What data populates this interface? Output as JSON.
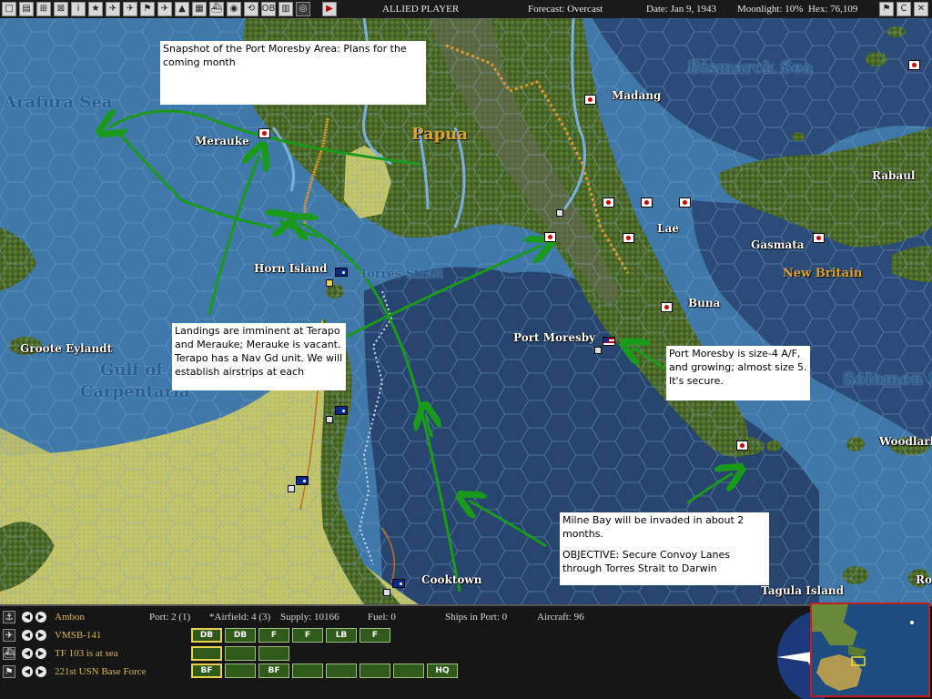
{
  "topbar": {
    "player": "ALLIED PLAYER",
    "forecast": "Forecast: Overcast",
    "date": "Date: Jan 9, 1943",
    "moonlight": "Moonlight: 10%",
    "hex": "Hex: 76,109",
    "tools": [
      {
        "name": "stop-icon",
        "glyph": "□"
      },
      {
        "name": "document-icon",
        "glyph": "▤"
      },
      {
        "name": "ships-icon",
        "glyph": "⊞"
      },
      {
        "name": "map-icon",
        "glyph": "⊠"
      },
      {
        "name": "info-icon",
        "glyph": "i"
      },
      {
        "name": "star-icon",
        "glyph": "★"
      },
      {
        "name": "red-plane-icon",
        "glyph": "✈"
      },
      {
        "name": "red-plane-2-icon",
        "glyph": "✈"
      },
      {
        "name": "flag-icon",
        "glyph": "⚑"
      },
      {
        "name": "aircraft-icon",
        "glyph": "✈"
      },
      {
        "name": "chart-icon",
        "glyph": "▲"
      },
      {
        "name": "green-map-icon",
        "glyph": "▦"
      },
      {
        "name": "ship-icon",
        "glyph": "⛴"
      },
      {
        "name": "globe-icon",
        "glyph": "◉"
      },
      {
        "name": "recycle-icon",
        "glyph": "⟲"
      },
      {
        "name": "ob-icon",
        "glyph": "OB"
      },
      {
        "name": "database-icon",
        "glyph": "▥"
      },
      {
        "name": "circle-icon",
        "glyph": "◎"
      },
      {
        "name": "play-icon",
        "glyph": "▶"
      }
    ],
    "right_buttons": [
      {
        "name": "flag-button",
        "glyph": "⚑"
      },
      {
        "name": "c-button",
        "glyph": "C"
      },
      {
        "name": "close-button",
        "glyph": "✕"
      }
    ]
  },
  "map": {
    "places": {
      "madang": "Madang",
      "merauke": "Merauke",
      "horn_island": "Horn Island",
      "lae": "Lae",
      "gasmata": "Gasmata",
      "rabaul": "Rabaul",
      "buna": "Buna",
      "port_moresby": "Port Moresby",
      "groote_eylandt": "Groote Eylandt",
      "woodlark": "Woodlark",
      "cooktown": "Cooktown",
      "tagula_island": "Tagula Island",
      "ro": "Ro"
    },
    "seas": {
      "arafura": "Arafura Sea",
      "bismarck": "Bismarck Sea",
      "torres": "Torres Strait",
      "gulf_line1": "Gulf of",
      "gulf_line2": "Carpentaria",
      "solomon": "Solomon Se"
    },
    "regions": {
      "papua": "Papua",
      "new_britain": "New Britain"
    },
    "notes": {
      "snapshot": "Snapshot of the Port Moresby Area:  Plans for the coming month",
      "landings": "Landings are imminent at Terapo and Merauke; Merauke is vacant.  Terapo has a Nav Gd unit.  We will establish airstrips at each",
      "moresby": "Port Moresby is size-4 A/F, and growing; almost size 5.  It's secure.",
      "milne_1": "Milne Bay will be invaded in about 2 months.",
      "milne_2": "OBJECTIVE:  Secure Convoy Lanes through Torres Strait to Darwin"
    }
  },
  "bottom": {
    "rows": [
      {
        "icon": "anchor-icon",
        "glyph": "⚓",
        "label": "Ambon"
      },
      {
        "icon": "plane-icon",
        "glyph": "✈",
        "label": "VMSB-141"
      },
      {
        "icon": "ship-icon",
        "glyph": "⛴",
        "label": "TF 103 is at sea"
      },
      {
        "icon": "flag-icon",
        "glyph": "⚑",
        "label": "221st USN Base Force"
      }
    ],
    "stats": {
      "port": "Port: 2 (1)",
      "airfield": "*Airfield: 4 (3)",
      "supply": "Supply: 10166",
      "fuel": "Fuel: 0",
      "ships": "Ships in Port: 0",
      "aircraft": "Aircraft: 96"
    },
    "air_buttons": [
      "DB",
      "DB",
      "F",
      "F",
      "LB",
      "F"
    ],
    "ship_buttons": [
      "",
      "",
      ""
    ],
    "ground_buttons": [
      "BF",
      "",
      "BF",
      "",
      "",
      "",
      "",
      "HQ"
    ]
  },
  "colors": {
    "shallow_sea": "#3f78a9",
    "deep_sea": "#26446e",
    "land": "#4f6a2c",
    "plains": "#c2c46a",
    "arrow": "#1a9a1a",
    "label_gold": "#d9b84a"
  }
}
